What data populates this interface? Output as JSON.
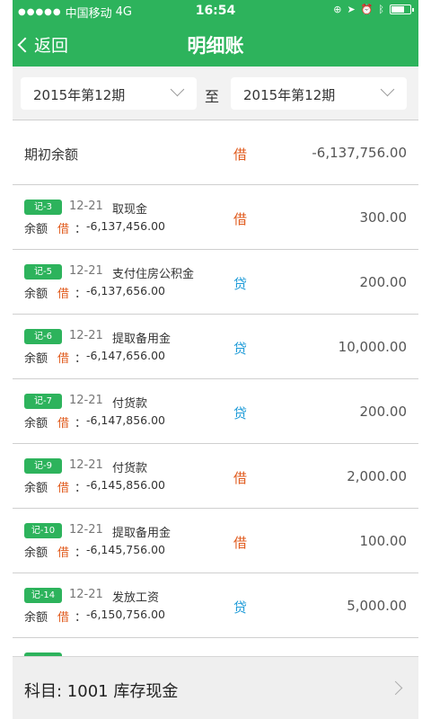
{
  "status": {
    "carrier": "中国移动",
    "network": "4G",
    "time": "16:54"
  },
  "nav": {
    "back_label": "返回",
    "title": "明细账"
  },
  "period": {
    "from": "2015年第12期",
    "to_label": "至",
    "to": "2015年第12期"
  },
  "opening": {
    "label": "期初余额",
    "direction": "借",
    "amount": "-6,137,756.00"
  },
  "balance_label": "余额",
  "colon": "：",
  "entries": [
    {
      "voucher": "记-3",
      "date": "12-21",
      "desc": "取现金",
      "direction": "借",
      "dir_type": "debit",
      "amount": "300.00",
      "bal_dir": "借",
      "balance": "-6,137,456.00"
    },
    {
      "voucher": "记-5",
      "date": "12-21",
      "desc": "支付住房公积金",
      "direction": "贷",
      "dir_type": "credit",
      "amount": "200.00",
      "bal_dir": "借",
      "balance": "-6,137,656.00"
    },
    {
      "voucher": "记-6",
      "date": "12-21",
      "desc": "提取备用金",
      "direction": "贷",
      "dir_type": "credit",
      "amount": "10,000.00",
      "bal_dir": "借",
      "balance": "-6,147,656.00"
    },
    {
      "voucher": "记-7",
      "date": "12-21",
      "desc": "付货款",
      "direction": "贷",
      "dir_type": "credit",
      "amount": "200.00",
      "bal_dir": "借",
      "balance": "-6,147,856.00"
    },
    {
      "voucher": "记-9",
      "date": "12-21",
      "desc": "付货款",
      "direction": "借",
      "dir_type": "debit",
      "amount": "2,000.00",
      "bal_dir": "借",
      "balance": "-6,145,856.00"
    },
    {
      "voucher": "记-10",
      "date": "12-21",
      "desc": "提取备用金",
      "direction": "借",
      "dir_type": "debit",
      "amount": "100.00",
      "bal_dir": "借",
      "balance": "-6,145,756.00"
    },
    {
      "voucher": "记-14",
      "date": "12-21",
      "desc": "发放工资",
      "direction": "贷",
      "dir_type": "credit",
      "amount": "5,000.00",
      "bal_dir": "借",
      "balance": "-6,150,756.00"
    }
  ],
  "footer": {
    "label": "科目:  1001 库存现金"
  },
  "colors": {
    "primary_green": "#2db35c",
    "debit_orange": "#e05a1c",
    "credit_blue": "#1e9bd8"
  },
  "icons": [
    "signal-dots-icon",
    "lock-rotation-icon",
    "location-arrow-icon",
    "alarm-icon",
    "bluetooth-icon",
    "battery-icon",
    "back-chevron-icon",
    "chevron-down-icon",
    "chevron-right-icon"
  ]
}
